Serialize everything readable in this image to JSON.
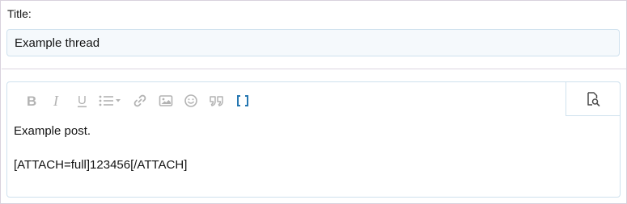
{
  "title_field": {
    "label": "Title:",
    "value": "Example thread"
  },
  "editor": {
    "toolbar": {
      "buttons": [
        {
          "name": "bold-icon",
          "glyph": "B"
        },
        {
          "name": "italic-icon",
          "glyph": "I"
        },
        {
          "name": "underline-icon",
          "glyph": "U"
        },
        {
          "name": "list-icon",
          "glyph": ""
        },
        {
          "name": "link-icon",
          "glyph": ""
        },
        {
          "name": "image-icon",
          "glyph": ""
        },
        {
          "name": "smilie-icon",
          "glyph": ""
        },
        {
          "name": "quote-icon",
          "glyph": ""
        },
        {
          "name": "code-icon",
          "glyph": "[ ]"
        }
      ],
      "preview_icon": "preview-icon",
      "icon_color": "#b3b3b3",
      "accent_color": "#2577b1"
    },
    "body": {
      "line1": "Example post.",
      "line2": "[ATTACH=full]123456[/ATTACH]"
    }
  }
}
